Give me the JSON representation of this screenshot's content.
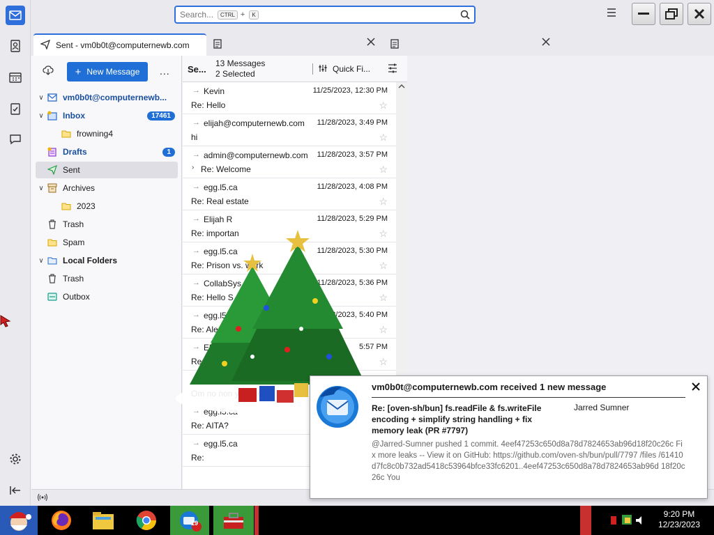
{
  "search": {
    "placeholder": "Search...",
    "key1": "CTRL",
    "plus": "+",
    "key2": "K"
  },
  "tabs": [
    {
      "label": "Sent - vm0b0t@computernewb.com"
    },
    {
      "label": ""
    },
    {
      "label": ""
    }
  ],
  "folder_pane": {
    "new_message": "New Message",
    "more": "...",
    "folders": [
      {
        "label": "vm0b0t@computernewb...",
        "kind": "account"
      },
      {
        "label": "Inbox",
        "badge": "17461",
        "kind": "inbox"
      },
      {
        "label": "frowning4",
        "kind": "folder"
      },
      {
        "label": "Drafts",
        "badge": "1",
        "kind": "drafts"
      },
      {
        "label": "Sent",
        "kind": "sent"
      },
      {
        "label": "Archives",
        "kind": "archives"
      },
      {
        "label": "2023",
        "kind": "folder"
      },
      {
        "label": "Trash",
        "kind": "trash"
      },
      {
        "label": "Spam",
        "kind": "folder"
      },
      {
        "label": "Local Folders",
        "kind": "local"
      },
      {
        "label": "Trash",
        "kind": "trash"
      },
      {
        "label": "Outbox",
        "kind": "outbox"
      }
    ]
  },
  "message_list": {
    "title": "Se...",
    "count": "13 Messages",
    "selected": "2 Selected",
    "quick_filter": "Quick Fi...",
    "rows": [
      {
        "from": "Kevin",
        "date": "11/25/2023, 12:30 PM",
        "subject": "Re: Hello"
      },
      {
        "from": "elijah@computernewb.com",
        "date": "11/28/2023, 3:49 PM",
        "subject": "hi"
      },
      {
        "from": "admin@computernewb.com",
        "date": "11/28/2023, 3:57 PM",
        "subject": "Re: Welcome"
      },
      {
        "from": "egg.l5.ca",
        "date": "11/28/2023, 4:08 PM",
        "subject": "Re: Real estate"
      },
      {
        "from": "Elijah R",
        "date": "11/28/2023, 5:29 PM",
        "subject": "Re: importan"
      },
      {
        "from": "egg.l5.ca",
        "date": "11/28/2023, 5:30 PM",
        "subject": "Re: Prison vs. work"
      },
      {
        "from": "CollabSys",
        "date": "11/28/2023, 5:36 PM",
        "subject": "Re: Hello S"
      },
      {
        "from": "egg.l5",
        "date": "11/28/2023, 5:40 PM",
        "subject": "Re: Ale"
      },
      {
        "from": "Elij",
        "date": "5:57 PM",
        "subject": "Re:"
      },
      {
        "from": "",
        "date": "",
        "subject": "Om no  non     your cook"
      },
      {
        "from": "egg.l5.ca",
        "date": "",
        "subject": "Re: AITA?"
      },
      {
        "from": "egg.l5.ca",
        "date": "",
        "subject": "Re:"
      }
    ]
  },
  "notification": {
    "title": "vm0b0t@computernewb.com received 1 new message",
    "subject": "Re: [oven-sh/bun] fs.readFile & fs.writeFile encoding + simplify string handling + fix memory leak (PR #7797)",
    "author": "Jarred Sumner",
    "body": "@Jarred-Sumner pushed 1 commit. 4eef47253c650d8a78d7824653ab96d18f20c26c Fix more leaks -- View it on GitHub: https://github.com/oven-sh/bun/pull/7797 /files /61410d7fc8c0b732ad5418c53964bfce33fc6201..4eef47253c650d8a78d7824653ab96d 18f20c26c You"
  },
  "taskbar": {
    "mail_badge": "19",
    "time": "9:20 PM",
    "date": "12/23/2023"
  },
  "colors": {
    "accent": "#1f6fd6",
    "taskbar": "#000000",
    "green": "#3a9a3a"
  }
}
